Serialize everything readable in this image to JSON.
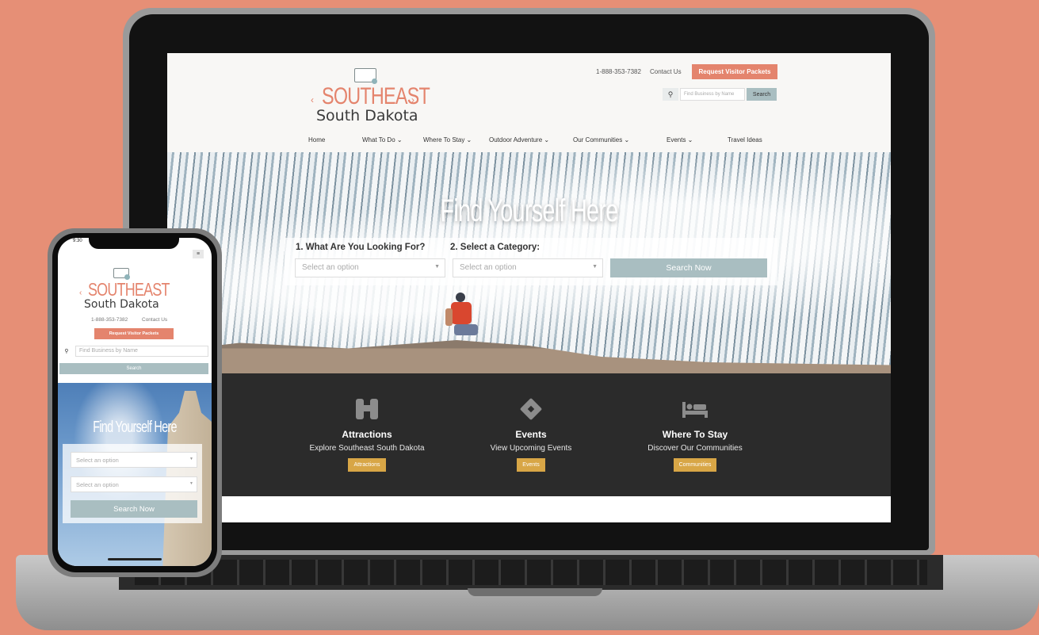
{
  "desktop": {
    "logo": {
      "line1": "SOUTHEAST",
      "line2": "South Dakota"
    },
    "utility": {
      "phone": "1-888-353-7382",
      "contact": "Contact Us",
      "request_button": "Request Visitor Packets"
    },
    "search": {
      "placeholder": "Find Business by Name",
      "button": "Search"
    },
    "nav": [
      {
        "label": "Home"
      },
      {
        "label": "What To Do ⌄"
      },
      {
        "label": "Where To Stay ⌄"
      },
      {
        "label": "Outdoor Adventure ⌄"
      },
      {
        "label": "Our Communities ⌄"
      },
      {
        "label": "Events ⌄"
      },
      {
        "label": "Travel Ideas"
      }
    ],
    "hero": {
      "title": "Find Yourself Here",
      "label1": "1. What Are You Looking For?",
      "label2": "2. Select a Category:",
      "select1": "Select an option",
      "select2": "Select an option",
      "search_button": "Search Now"
    },
    "features": [
      {
        "title": "Attractions",
        "subtitle": "Explore Southeast South Dakota",
        "button": "Attractions",
        "icon": "binoculars-icon"
      },
      {
        "title": "Events",
        "subtitle": "View Upcoming Events",
        "button": "Events",
        "icon": "ticket-icon"
      },
      {
        "title": "Where To Stay",
        "subtitle": "Discover Our Communities",
        "button": "Communities",
        "icon": "bed-icon"
      }
    ]
  },
  "mobile": {
    "status_time": "9:30",
    "logo": {
      "line1": "SOUTHEAST",
      "line2": "South Dakota"
    },
    "phone": "1-888-353-7382",
    "contact": "Contact Us",
    "request_button": "Request Visitor Packets",
    "search": {
      "placeholder": "Find Business by Name",
      "button": "Search"
    },
    "hero": {
      "title": "Find Yourself Here",
      "select1": "Select an option",
      "select2": "Select an option",
      "search_button": "Search Now"
    }
  },
  "colors": {
    "background": "#e68f76",
    "brand_salmon": "#e4846d",
    "button_teal": "#a9bec1",
    "accent_gold": "#d8a646",
    "panel_dark": "#2b2b2b"
  }
}
